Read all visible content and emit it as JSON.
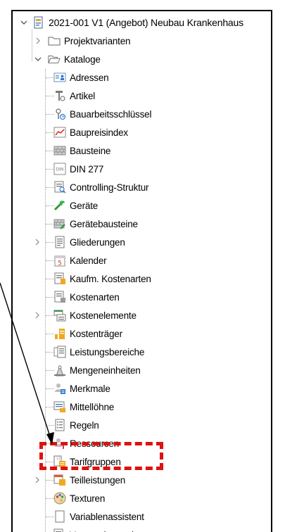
{
  "tree": {
    "root": {
      "label": "2021-001 V1 (Angebot) Neubau Krankenhaus",
      "icon": "project-icon",
      "expanded": true
    },
    "level1": [
      {
        "label": "Projektvarianten",
        "icon": "folder-icon",
        "expanded": false
      },
      {
        "label": "Kataloge",
        "icon": "open-folder-icon",
        "expanded": true
      }
    ],
    "items": [
      {
        "label": "Adressen",
        "icon": "address-card-icon",
        "has_children": false
      },
      {
        "label": "Artikel",
        "icon": "article-icon",
        "has_children": false
      },
      {
        "label": "Bauarbeitsschlüssel",
        "icon": "key-icon",
        "has_children": false
      },
      {
        "label": "Baupreisindex",
        "icon": "price-index-chart-icon",
        "has_children": false
      },
      {
        "label": "Bausteine",
        "icon": "building-blocks-icon",
        "has_children": false
      },
      {
        "label": "DIN 277",
        "icon": "din-icon",
        "has_children": false
      },
      {
        "label": "Controlling-Struktur",
        "icon": "controlling-structure-icon",
        "has_children": false
      },
      {
        "label": "Geräte",
        "icon": "tool-icon",
        "has_children": false
      },
      {
        "label": "Gerätebausteine",
        "icon": "device-blocks-icon",
        "has_children": false
      },
      {
        "label": "Gliederungen",
        "icon": "outline-document-icon",
        "has_children": true
      },
      {
        "label": "Kalender",
        "icon": "calendar-icon",
        "has_children": false
      },
      {
        "label": "Kaufm. Kostenarten",
        "icon": "commercial-cost-types-icon",
        "has_children": false
      },
      {
        "label": "Kostenarten",
        "icon": "cost-types-icon",
        "has_children": false
      },
      {
        "label": "Kostenelemente",
        "icon": "cost-elements-icon",
        "has_children": true
      },
      {
        "label": "Kostenträger",
        "icon": "cost-carrier-icon",
        "has_children": false
      },
      {
        "label": "Leistungsbereiche",
        "icon": "service-areas-icon",
        "has_children": false
      },
      {
        "label": "Mengeneinheiten",
        "icon": "units-icon",
        "has_children": false
      },
      {
        "label": "Merkmale",
        "icon": "attributes-icon",
        "has_children": false
      },
      {
        "label": "Mittellöhne",
        "icon": "average-wages-icon",
        "has_children": false
      },
      {
        "label": "Regeln",
        "icon": "rules-icon",
        "has_children": false
      },
      {
        "label": "Ressourcen",
        "icon": "resources-icon",
        "has_children": false
      },
      {
        "label": "Tarifgruppen",
        "icon": "tariff-groups-icon",
        "has_children": false
      },
      {
        "label": "Teilleistungen",
        "icon": "partial-services-icon",
        "has_children": true
      },
      {
        "label": "Texturen",
        "icon": "textures-palette-icon",
        "has_children": false
      },
      {
        "label": "Variablenassistent",
        "icon": "variable-assistant-icon",
        "has_children": false
      },
      {
        "label": "Vertragsbausteine",
        "icon": "contract-blocks-icon",
        "has_children": false
      }
    ]
  },
  "annotation": {
    "highlighted_item": "Tarifgruppen",
    "highlight_color": "#e01010",
    "arrow_color": "#000000"
  }
}
